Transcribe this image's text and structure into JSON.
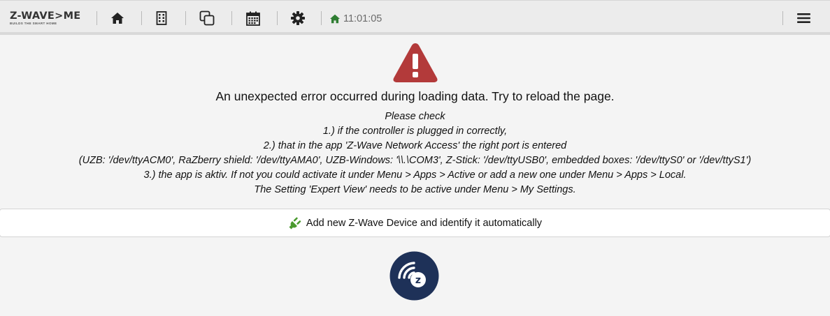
{
  "brand": {
    "name": "Z-WAVE>ME",
    "tagline": "BUILDS THE SMART HOME"
  },
  "navbar": {
    "icons": [
      "home-icon",
      "building-icon",
      "copy-icon",
      "calendar-icon",
      "gear-icon"
    ],
    "clock": "11:01:05",
    "menu_icon": "hamburger-icon"
  },
  "colors": {
    "warning": "#b33a3a",
    "plug": "#4a9a2e",
    "clock_home": "#2e7d32",
    "zwave_badge": "#1e3158"
  },
  "error": {
    "title": "An unexpected error occurred during loading data. Try to reload the page.",
    "hints": [
      "Please check",
      "1.) if the controller is plugged in correctly,",
      "2.) that in the app 'Z-Wave Network Access' the right port is entered",
      "(UZB: '/dev/ttyACM0', RaZberry shield: '/dev/ttyAMA0', UZB-Windows: '\\\\.\\COM3', Z-Stick: '/dev/ttyUSB0', embedded boxes: '/dev/ttyS0' or '/dev/ttyS1')",
      "3.) the app is aktiv. If not you could activate it under Menu > Apps > Active or add a new one under Menu > Apps > Local.",
      "The Setting 'Expert View' needs to be active under Menu > My Settings."
    ]
  },
  "add_device": {
    "label": "Add new Z-Wave Device and identify it automatically",
    "icon": "plug-icon"
  },
  "badge": {
    "letter": "z"
  }
}
